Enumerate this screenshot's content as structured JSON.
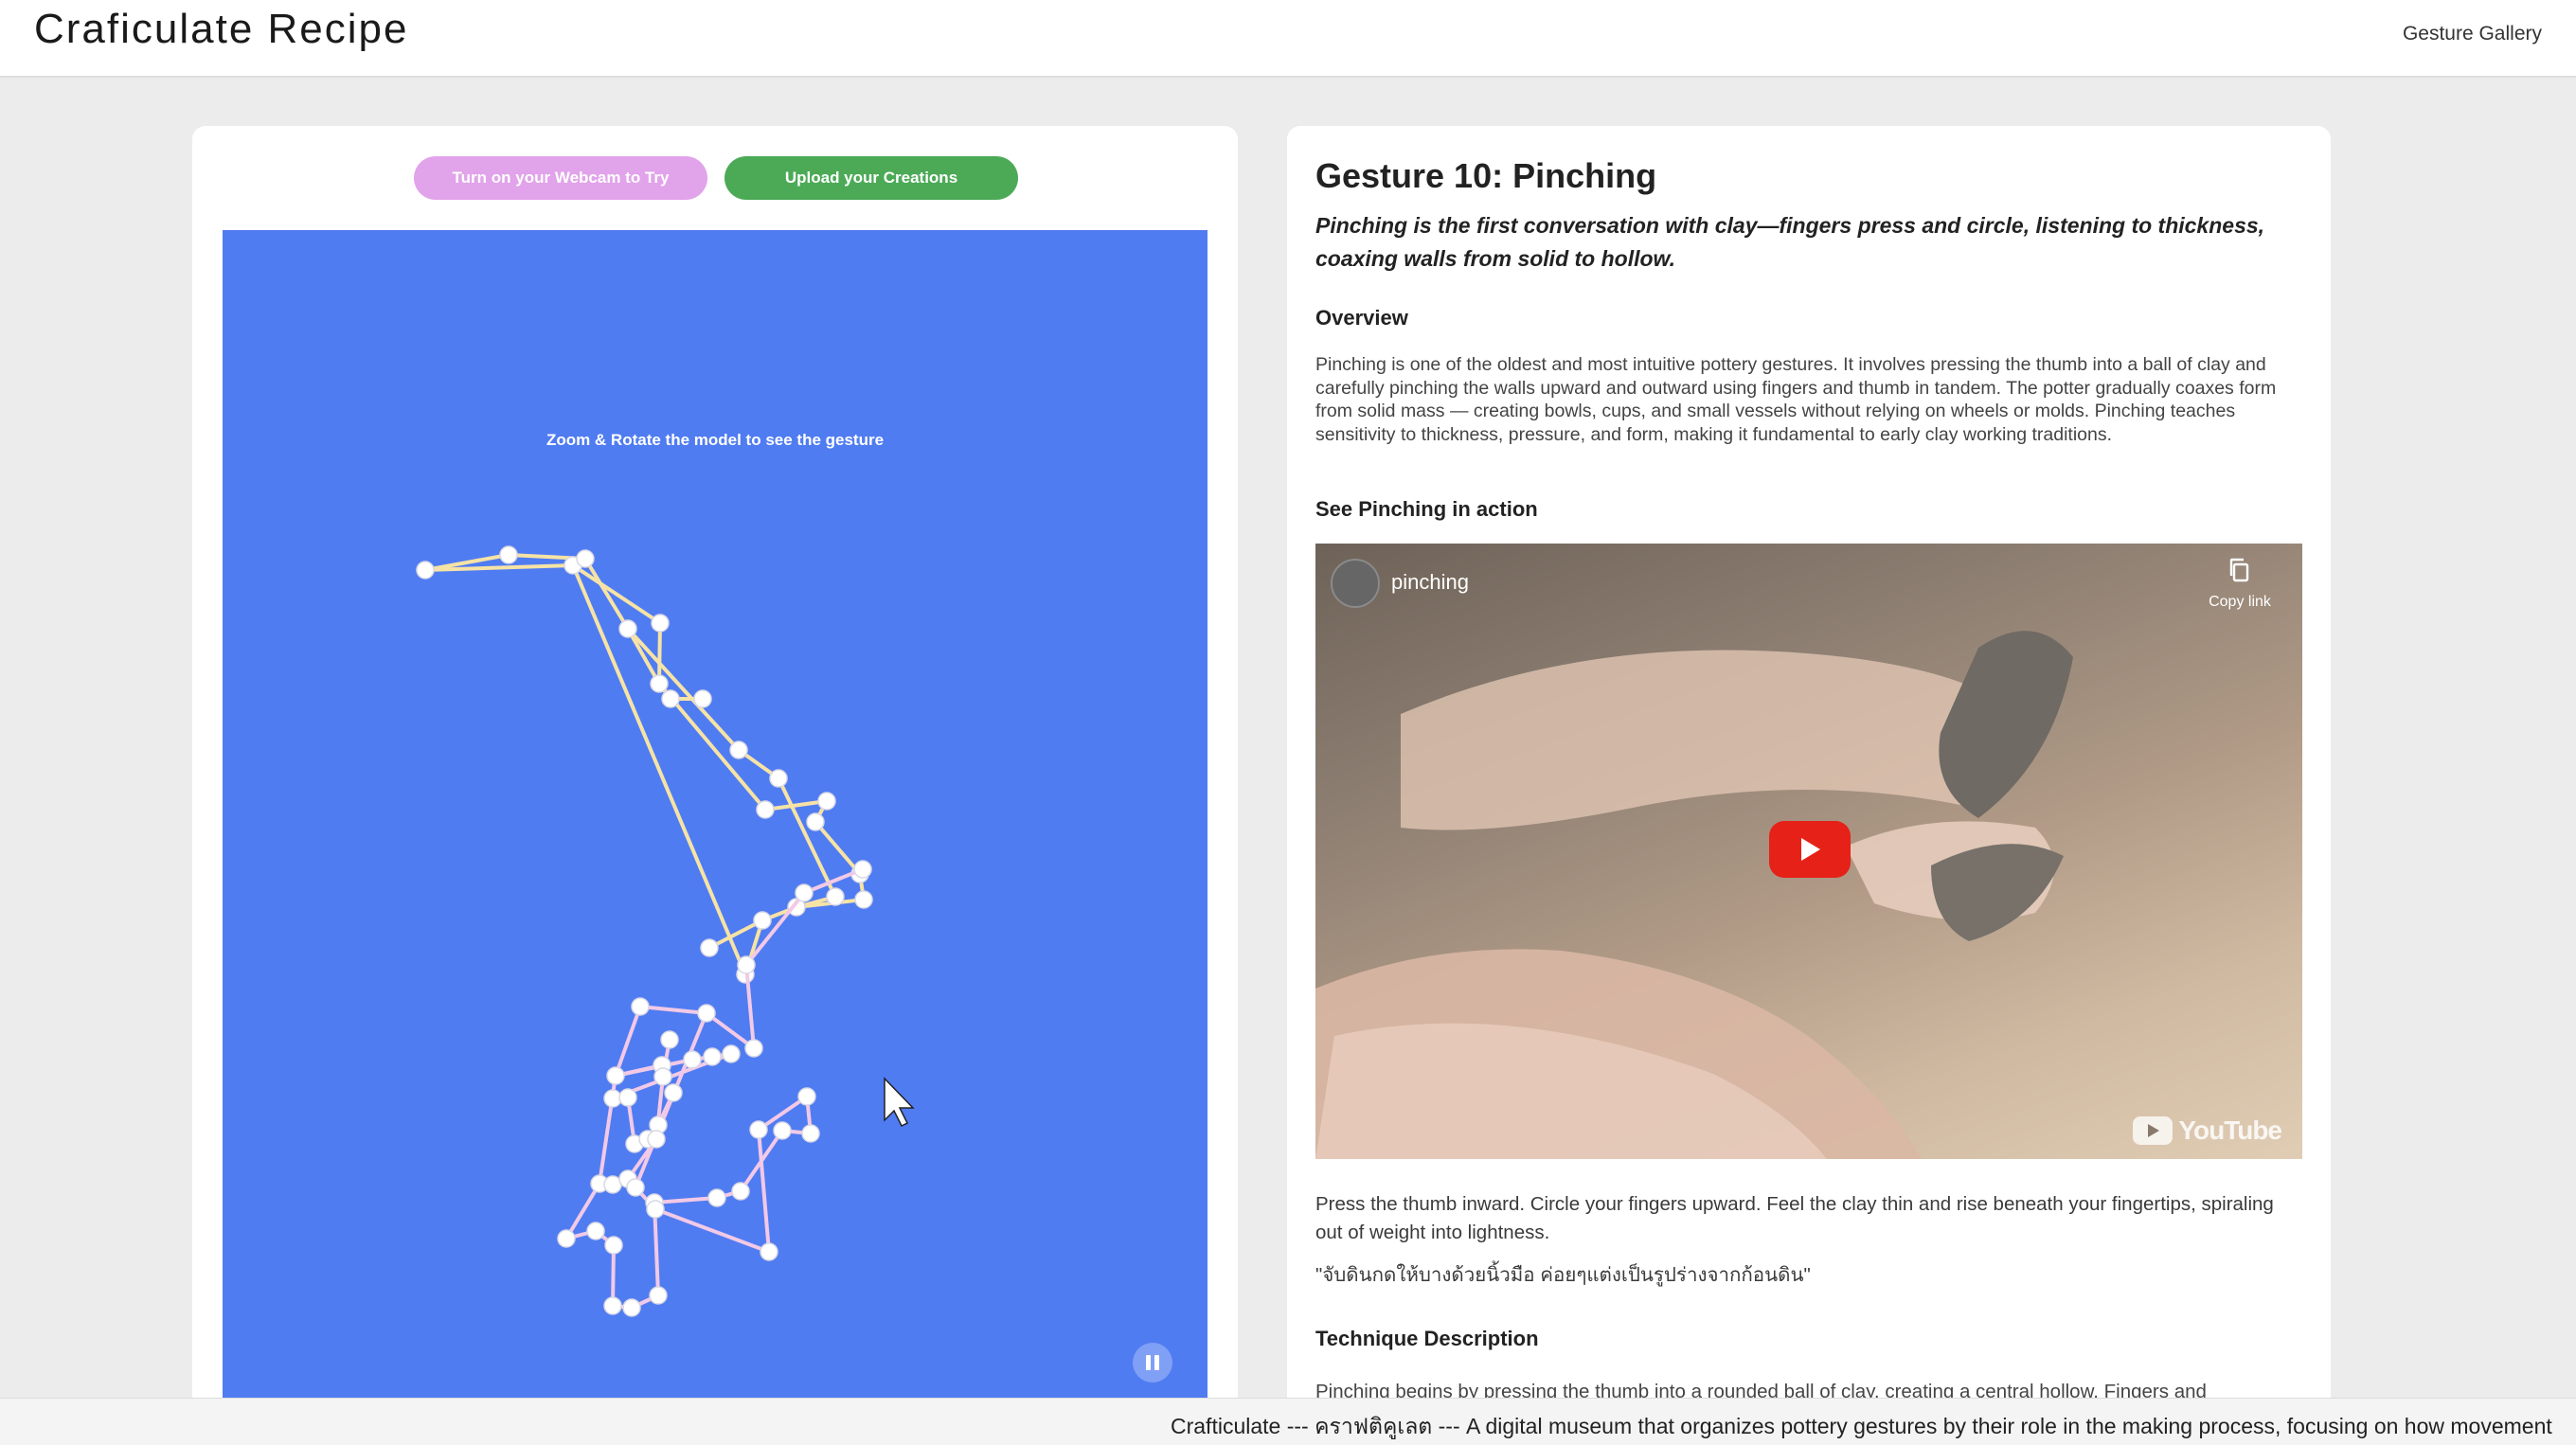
{
  "header": {
    "brand": "Craficulate Recipe",
    "nav_link": "Gesture Gallery"
  },
  "left_panel": {
    "webcam_button": "Turn on your Webcam to Try",
    "upload_button": "Upload your Creations",
    "stage_hint": "Zoom & Rotate the model to see the gesture",
    "pause_icon": "pause-icon",
    "colors": {
      "stage_bg": "#507cf2",
      "webcam_btn": "#e1a3ea",
      "upload_btn": "#4caa57",
      "bone_yellow": "#f6e3a5",
      "bone_pink": "#f2c9e6"
    }
  },
  "right_panel": {
    "title": "Gesture 10: Pinching",
    "tagline": "Pinching is the first conversation with clay—fingers press and circle, listening to thickness, coaxing walls from solid to hollow.",
    "overview_heading": "Overview",
    "overview_text": "Pinching is one of the oldest and most intuitive pottery gestures. It involves pressing the thumb into a ball of clay and carefully pinching the walls upward and outward using fingers and thumb in tandem. The potter gradually coaxes form from solid mass — creating bowls, cups, and small vessels without relying on wheels or molds. Pinching teaches sensitivity to thickness, pressure, and form, making it fundamental to early clay working traditions.",
    "video_heading": "See Pinching in action",
    "video": {
      "channel_name": "pinching",
      "copy_link": "Copy link",
      "youtube_label": "YouTube",
      "play_icon": "play-icon"
    },
    "instruction_text": "Press the thumb inward. Circle your fingers upward. Feel the clay thin and rise beneath your fingertips, spiraling out of weight into lightness.",
    "thai_quote": "\"จับดินกดให้บางด้วยนิ้วมือ ค่อยๆแต่งเป็นรูปร่างจากก้อนดิน\"",
    "technique_heading": "Technique Description",
    "technique_text": "Pinching begins by pressing the thumb into a rounded ball of clay, creating a central hollow. Fingers and"
  },
  "footer": {
    "ticker": "Crafticulate --- คราฟติคูเลต --- A digital museum that organizes pottery gestures by their role in the making process, focusing on how movement"
  }
}
